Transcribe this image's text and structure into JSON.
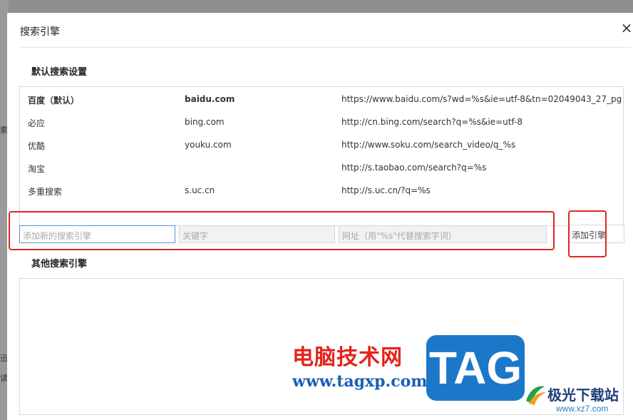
{
  "background": {
    "fragments": [
      "索",
      "迅",
      "读"
    ]
  },
  "dialog": {
    "title": "搜索引擎",
    "close_label": "×"
  },
  "default_section": {
    "title": "默认搜索设置",
    "engines": [
      {
        "name": "百度（默认）",
        "keyword": "baidu.com",
        "url": "https://www.baidu.com/s?wd=%s&ie=utf-8&tn=02049043_27_pg",
        "is_default": true
      },
      {
        "name": "必应",
        "keyword": "bing.com",
        "url": "http://cn.bing.com/search?q=%s&ie=utf-8",
        "is_default": false
      },
      {
        "name": "优酷",
        "keyword": "youku.com",
        "url": "http://www.soku.com/search_video/q_%s",
        "is_default": false
      },
      {
        "name": "淘宝",
        "keyword": "",
        "url": "http://s.taobao.com/search?q=%s",
        "is_default": false
      },
      {
        "name": "多重搜索",
        "keyword": "s.uc.cn",
        "url": "http://s.uc.cn/?q=%s",
        "is_default": false
      }
    ]
  },
  "add_engine": {
    "name_placeholder": "添加新的搜索引擎",
    "keyword_placeholder": "关键字",
    "url_placeholder": "网址（用\"%s\"代替搜索字词）",
    "add_button_label": "添加引擎"
  },
  "other_section": {
    "title": "其他搜索引擎"
  },
  "watermark": {
    "site_name": "电脑技术网",
    "site_url": "www.tagxp.com",
    "tag_logo": "TAG",
    "logo_name": "极光下载站",
    "logo_url": "www.xz7.com"
  },
  "colors": {
    "highlight_red": "#e0261f",
    "focus_blue": "#5b8fd1",
    "tag_blue": "#1b78c8"
  }
}
